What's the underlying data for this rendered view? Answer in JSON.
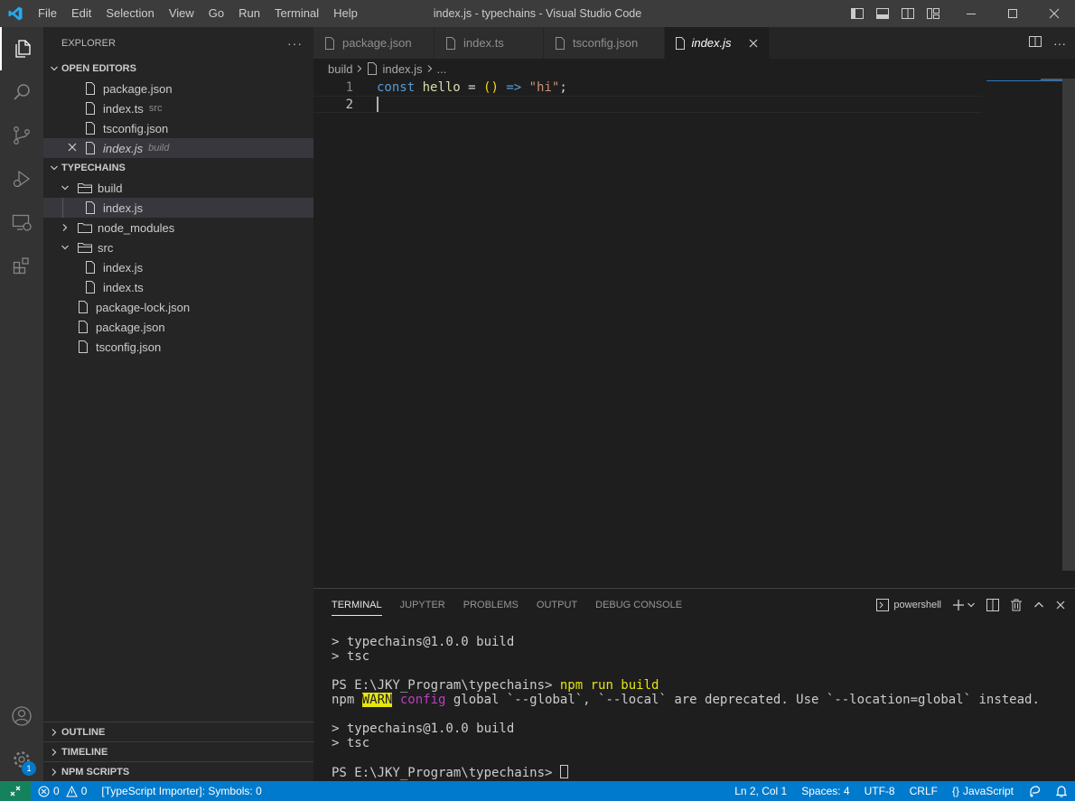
{
  "titlebar": {
    "title": "index.js - typechains - Visual Studio Code",
    "menu": [
      "File",
      "Edit",
      "Selection",
      "View",
      "Go",
      "Run",
      "Terminal",
      "Help"
    ]
  },
  "sidebar": {
    "header": "EXPLORER",
    "open_editors": {
      "title": "OPEN EDITORS",
      "items": [
        {
          "name": "package.json",
          "desc": ""
        },
        {
          "name": "index.ts",
          "desc": "src"
        },
        {
          "name": "tsconfig.json",
          "desc": ""
        },
        {
          "name": "index.js",
          "desc": "build"
        }
      ]
    },
    "workspace": {
      "title": "TYPECHAINS",
      "tree": [
        {
          "name": "build"
        },
        {
          "name": "index.js"
        },
        {
          "name": "node_modules"
        },
        {
          "name": "src"
        },
        {
          "name": "index.js"
        },
        {
          "name": "index.ts"
        },
        {
          "name": "package-lock.json"
        },
        {
          "name": "package.json"
        },
        {
          "name": "tsconfig.json"
        }
      ]
    },
    "bottom_sections": [
      "OUTLINE",
      "TIMELINE",
      "NPM SCRIPTS"
    ]
  },
  "tabs": [
    {
      "label": "package.json"
    },
    {
      "label": "index.ts"
    },
    {
      "label": "tsconfig.json"
    },
    {
      "label": "index.js"
    }
  ],
  "breadcrumb": [
    "build",
    "index.js",
    "..."
  ],
  "editor": {
    "line_numbers": [
      "1",
      "2"
    ],
    "tokens": {
      "const": "const",
      "name": "hello",
      "eq": " = ",
      "parens": "()",
      "arrow": " => ",
      "string": "\"hi\"",
      "semi": ";"
    }
  },
  "panel": {
    "tabs": [
      "TERMINAL",
      "JUPYTER",
      "PROBLEMS",
      "OUTPUT",
      "DEBUG CONSOLE"
    ],
    "shell": "powershell",
    "terminal": {
      "l1": "> typechains@1.0.0 build",
      "l2": "> tsc",
      "prompt1": "PS E:\\JKY_Program\\typechains> ",
      "cmd": "npm run build",
      "warn_npm": "npm ",
      "warn_tag": "WARN",
      "warn_config": "config",
      "warn_msg": " global `--global`, `--local` are deprecated. Use `--location=global` instead.",
      "l5": "> typechains@1.0.0 build",
      "l6": "> tsc",
      "prompt2": "PS E:\\JKY_Program\\typechains> "
    }
  },
  "statusbar": {
    "errors": "0",
    "warnings": "0",
    "importer": "[TypeScript Importer]: Symbols: 0",
    "position": "Ln 2, Col 1",
    "spaces": "Spaces: 4",
    "encoding": "UTF-8",
    "eol": "CRLF",
    "language": "JavaScript",
    "lang_icon": "{}",
    "accounts_badge": "1"
  },
  "colors": {
    "accent": "#007acc",
    "remote": "#16825d",
    "titlebar": "#3c3c3c",
    "sidebar": "#252526",
    "activity": "#333333"
  }
}
